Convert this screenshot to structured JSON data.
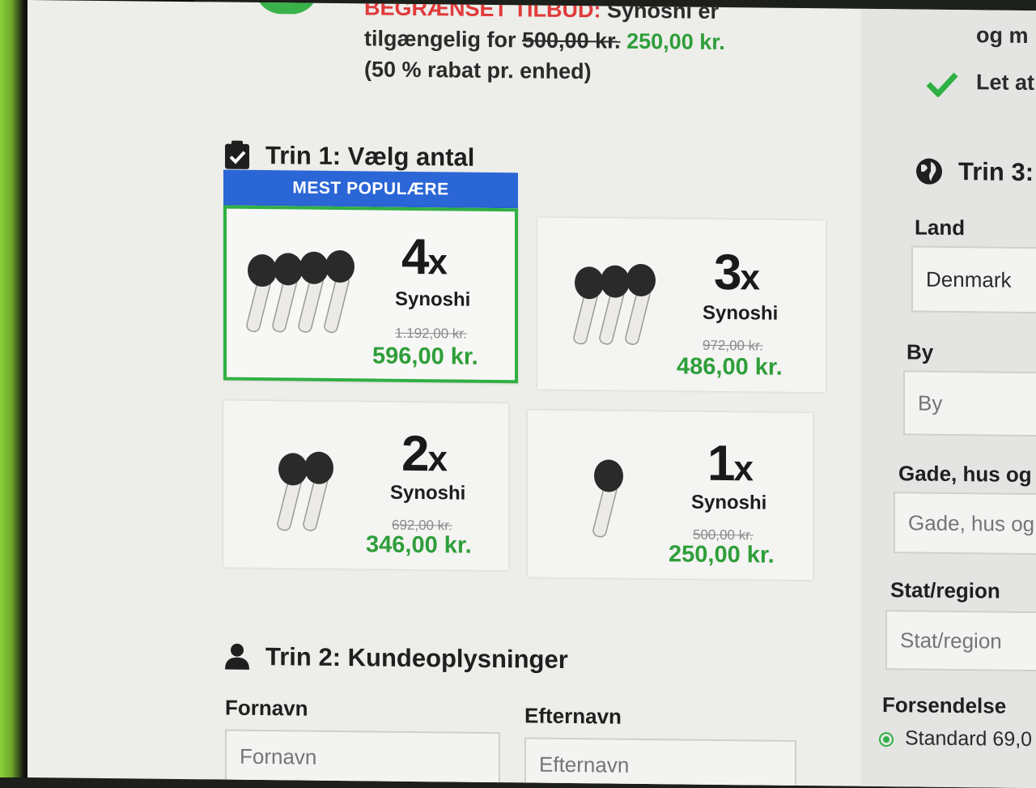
{
  "promo": {
    "label_partial": "BEGRÆNSET TILBUD:",
    "text_a": " Synoshi er",
    "text_b": "tilgængelig for ",
    "old_price": "500,00 kr.",
    "new_price": " 250,00 kr.",
    "note": "(50 % rabat pr. enhed)"
  },
  "features": {
    "line1": "og m",
    "line2": "Let at"
  },
  "step1": {
    "title": "Trin 1: Vælg antal",
    "badge": "MEST POPULÆRE"
  },
  "options": [
    {
      "qty": "4",
      "unit": "x",
      "name": "Synoshi",
      "old_price": "1.192,00 kr.",
      "price": "596,00 kr.",
      "selected": true
    },
    {
      "qty": "3",
      "unit": "x",
      "name": "Synoshi",
      "old_price": "972,00 kr.",
      "price": "486,00 kr.",
      "selected": false
    },
    {
      "qty": "2",
      "unit": "x",
      "name": "Synoshi",
      "old_price": "692,00 kr.",
      "price": "346,00 kr.",
      "selected": false
    },
    {
      "qty": "1",
      "unit": "x",
      "name": "Synoshi",
      "old_price": "500,00 kr.",
      "price": "250,00 kr.",
      "selected": false
    }
  ],
  "step2": {
    "title": "Trin 2: Kundeoplysninger",
    "first_name": {
      "label": "Fornavn",
      "placeholder": "Fornavn"
    },
    "last_name": {
      "label": "Efternavn",
      "placeholder": "Efternavn"
    }
  },
  "step3": {
    "title": "Trin 3:",
    "country": {
      "label": "Land",
      "value": "Denmark"
    },
    "city": {
      "label": "By",
      "placeholder": "By"
    },
    "street": {
      "label": "Gade, hus og",
      "placeholder": "Gade, hus og"
    },
    "region": {
      "label": "Stat/region",
      "placeholder": "Stat/region"
    },
    "shipping": {
      "label": "Forsendelse",
      "option": "Standard 69,0"
    }
  },
  "colors": {
    "green": "#2f9e3a",
    "badge_blue": "#2b66d6",
    "selected_border": "#2fb043"
  },
  "icons": [
    "clipboard-check-icon",
    "user-icon",
    "globe-icon",
    "checkmark-icon",
    "brush-product-icon"
  ]
}
